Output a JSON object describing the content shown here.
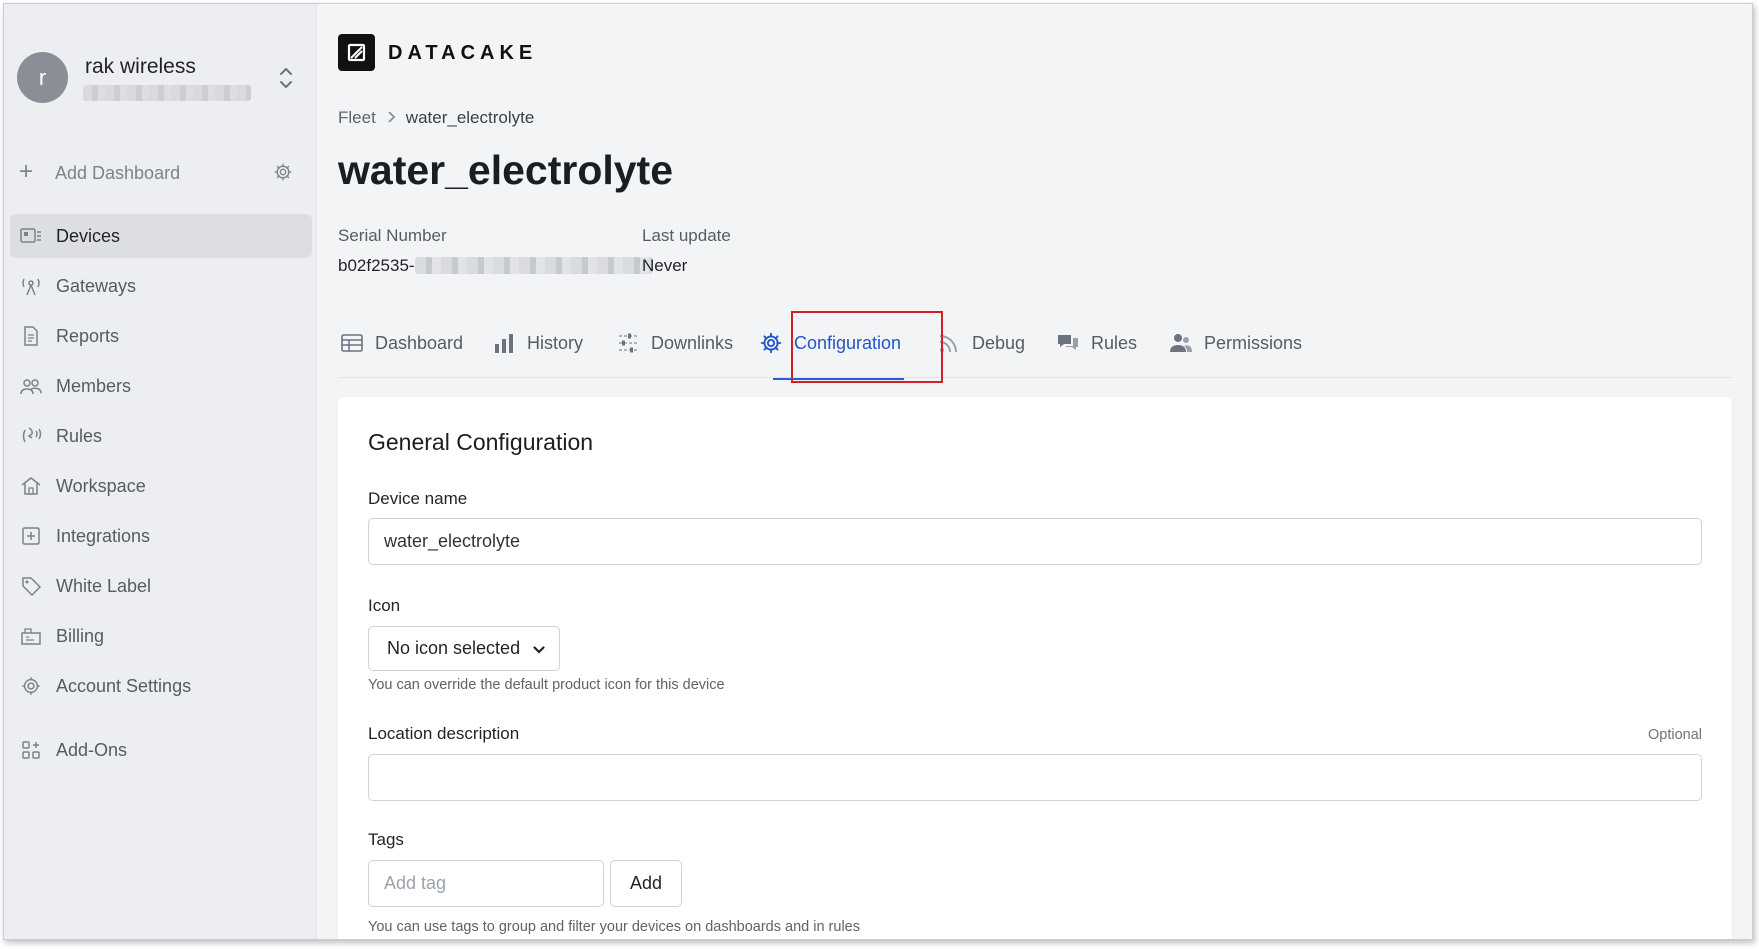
{
  "sidebar": {
    "workspace": {
      "avatar_letter": "r",
      "name": "rak wireless"
    },
    "add_dashboard": "Add Dashboard",
    "items": [
      {
        "label": "Devices",
        "icon": "device-card-icon",
        "active": true
      },
      {
        "label": "Gateways",
        "icon": "gateway-antenna-icon"
      },
      {
        "label": "Reports",
        "icon": "document-icon"
      },
      {
        "label": "Members",
        "icon": "users-icon"
      },
      {
        "label": "Rules",
        "icon": "rules-signal-icon"
      },
      {
        "label": "Workspace",
        "icon": "home-icon"
      },
      {
        "label": "Integrations",
        "icon": "plus-square-icon"
      },
      {
        "label": "White Label",
        "icon": "tag-icon"
      },
      {
        "label": "Billing",
        "icon": "billing-icon"
      },
      {
        "label": "Account Settings",
        "icon": "gear-icon"
      },
      {
        "label": "Add-Ons",
        "icon": "addons-grid-icon"
      }
    ]
  },
  "brand": {
    "logo_text": "DATACAKE"
  },
  "breadcrumb": {
    "root": "Fleet",
    "current": "water_electrolyte"
  },
  "page": {
    "title": "water_electrolyte",
    "serial_label": "Serial Number",
    "serial_value": "b02f2535-",
    "last_update_label": "Last update",
    "last_update_value": "Never"
  },
  "tabs": [
    {
      "label": "Dashboard",
      "icon": "table-icon"
    },
    {
      "label": "History",
      "icon": "bar-chart-icon"
    },
    {
      "label": "Downlinks",
      "icon": "sliders-icon"
    },
    {
      "label": "Configuration",
      "icon": "gear-icon",
      "active": true
    },
    {
      "label": "Debug",
      "icon": "rss-icon"
    },
    {
      "label": "Rules",
      "icon": "comments-icon"
    },
    {
      "label": "Permissions",
      "icon": "users-icon"
    }
  ],
  "config": {
    "heading": "General Configuration",
    "device_name_label": "Device name",
    "device_name_value": "water_electrolyte",
    "icon_label": "Icon",
    "icon_selected": "No icon selected",
    "icon_help": "You can override the default product icon for this device",
    "location_label": "Location description",
    "location_optional": "Optional",
    "location_value": "",
    "tags_label": "Tags",
    "tag_placeholder": "Add tag",
    "add_button": "Add",
    "tags_help": "You can use tags to group and filter your devices on dashboards and in rules"
  },
  "colors": {
    "accent": "#2155c9",
    "highlight_box": "#d22028",
    "sidebar_bg": "#eceef1",
    "page_bg": "#f3f4f6"
  }
}
